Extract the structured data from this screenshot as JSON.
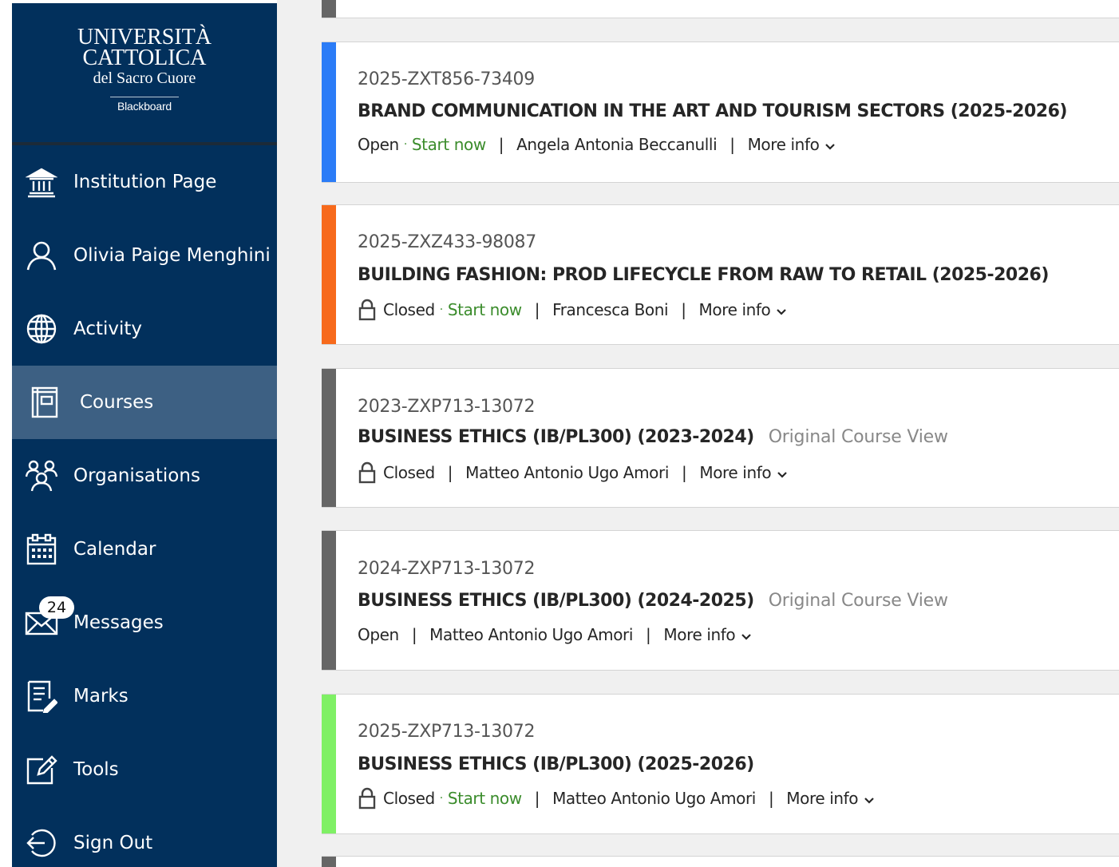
{
  "branding": {
    "line1": "UNIVERSITÀ",
    "line2": "CATTOLICA",
    "line3": "del Sacro Cuore",
    "line4": "Blackboard"
  },
  "sidebar": {
    "items": [
      {
        "label": "Institution Page",
        "icon": "institution-icon"
      },
      {
        "label": "Olivia Paige Menghini",
        "icon": "user-icon"
      },
      {
        "label": "Activity",
        "icon": "globe-icon"
      },
      {
        "label": "Courses",
        "icon": "courses-icon",
        "active": true
      },
      {
        "label": "Organisations",
        "icon": "organisations-icon"
      },
      {
        "label": "Calendar",
        "icon": "calendar-icon"
      },
      {
        "label": "Messages",
        "icon": "envelope-icon",
        "badge": "24"
      },
      {
        "label": "Marks",
        "icon": "marks-icon"
      },
      {
        "label": "Tools",
        "icon": "tools-icon"
      },
      {
        "label": "Sign Out",
        "icon": "sign-out-icon"
      }
    ]
  },
  "colors": {
    "sidebar_bg": "#02305c",
    "active_bg": "#3d6083",
    "start_now": "#3b8c2c"
  },
  "courses": [
    {
      "id": "2025-ZXT856-73409",
      "title": "BRAND COMMUNICATION IN THE ART AND TOURISM SECTORS (2025-2026)",
      "status": "Open",
      "start_now": "Start now",
      "instructor": "Angela Antonia Beccanulli",
      "more_info": "More info",
      "color": "#2b7cf7"
    },
    {
      "id": "2025-ZXZ433-98087",
      "title": "BUILDING FASHION: PROD LIFECYCLE FROM RAW TO RETAIL (2025-2026)",
      "status": "Closed",
      "start_now": "Start now",
      "instructor": "Francesca Boni",
      "more_info": "More info",
      "color": "#f76a1c"
    },
    {
      "id": "2023-ZXP713-13072",
      "title": "BUSINESS ETHICS (IB/PL300) (2023-2024)",
      "view": "Original Course View",
      "status": "Closed",
      "instructor": "Matteo Antonio Ugo Amori",
      "more_info": "More info",
      "color": "#666666"
    },
    {
      "id": "2024-ZXP713-13072",
      "title": "BUSINESS ETHICS (IB/PL300) (2024-2025)",
      "view": "Original Course View",
      "status": "Open",
      "instructor": "Matteo Antonio Ugo Amori",
      "more_info": "More info",
      "color": "#666666"
    },
    {
      "id": "2025-ZXP713-13072",
      "title": "BUSINESS ETHICS (IB/PL300) (2025-2026)",
      "status": "Closed",
      "start_now": "Start now",
      "instructor": "Matteo Antonio Ugo Amori",
      "more_info": "More info",
      "color": "#7ff065"
    }
  ]
}
